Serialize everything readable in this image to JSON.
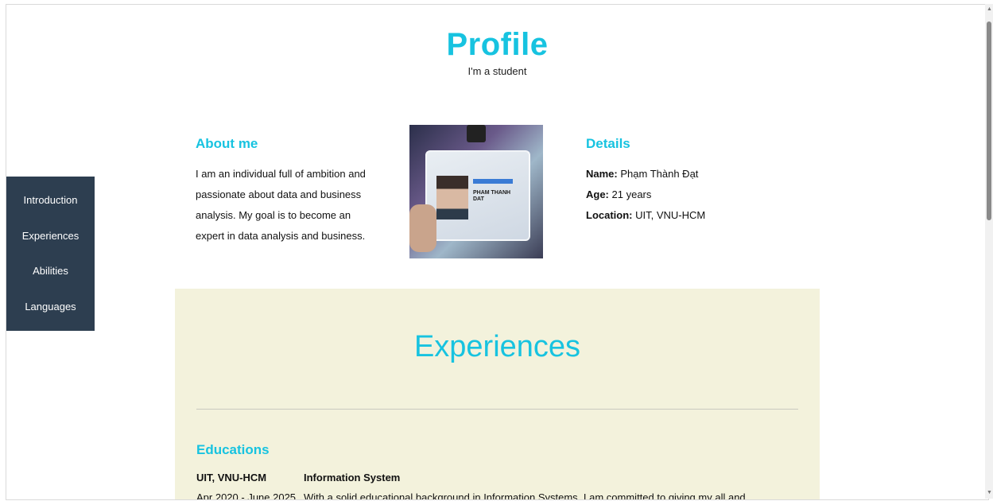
{
  "header": {
    "title": "Profile",
    "subtitle": "I'm a student"
  },
  "about": {
    "heading": "About me",
    "text": "I am an individual full of ambition and passionate about data and business analysis. My goal is to become an expert in data analysis and business."
  },
  "photo": {
    "card_name_line1": "PHAM THANH",
    "card_name_line2": "DAT"
  },
  "details": {
    "heading": "Details",
    "name_label": "Name:",
    "name_value": "Phạm Thành Đạt",
    "age_label": "Age:",
    "age_value": "21 years",
    "location_label": "Location:",
    "location_value": "UIT, VNU-HCM"
  },
  "sidenav": {
    "items": [
      {
        "label": "Introduction"
      },
      {
        "label": "Experiences"
      },
      {
        "label": "Abilities"
      },
      {
        "label": "Languages"
      }
    ]
  },
  "experiences": {
    "title": "Experiences",
    "education_heading": "Educations",
    "school": "UIT, VNU-HCM",
    "major": "Information System",
    "date": "Apr 2020 - June 2025",
    "description": "With a solid educational background in Information Systems, I am committed to giving my all and"
  },
  "colors": {
    "accent": "#17c3e0",
    "sidenav_bg": "#2d3e50",
    "panel_bg": "#f3f2dc"
  }
}
